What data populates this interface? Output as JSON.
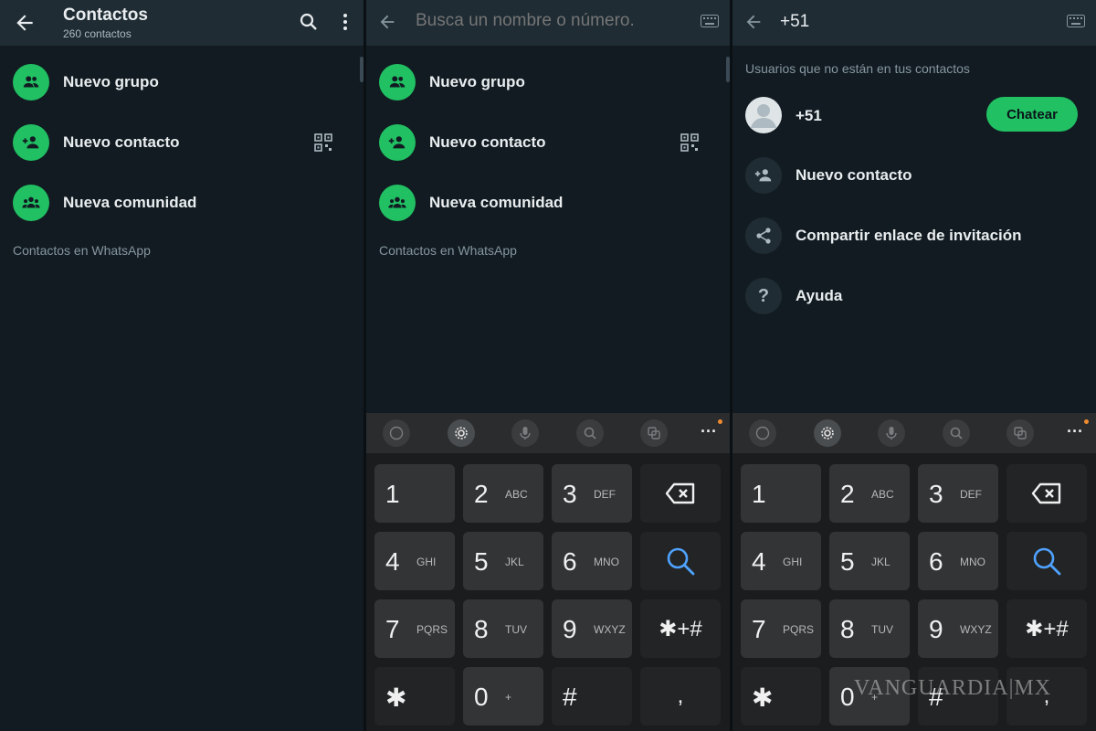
{
  "panel1": {
    "title": "Contactos",
    "subtitle": "260 contactos",
    "items": [
      {
        "label": "Nuevo grupo",
        "icon": "group-icon"
      },
      {
        "label": "Nuevo contacto",
        "icon": "add-person-icon"
      },
      {
        "label": "Nueva comunidad",
        "icon": "community-icon"
      }
    ],
    "section": "Contactos en WhatsApp"
  },
  "panel2": {
    "search_placeholder": "Busca un nombre o número.",
    "items": [
      {
        "label": "Nuevo grupo",
        "icon": "group-icon"
      },
      {
        "label": "Nuevo contacto",
        "icon": "add-person-icon"
      },
      {
        "label": "Nueva comunidad",
        "icon": "community-icon"
      }
    ],
    "section": "Contactos en WhatsApp"
  },
  "panel3": {
    "search_value": "+51",
    "section": "Usuarios que no están en tus contactos",
    "number": "+51",
    "chat_button": "Chatear",
    "items": [
      {
        "label": "Nuevo contacto",
        "icon": "add-person-icon"
      },
      {
        "label": "Compartir enlace de invitación",
        "icon": "share-icon"
      },
      {
        "label": "Ayuda",
        "icon": "help-icon"
      }
    ]
  },
  "keyboard": {
    "keys": [
      {
        "num": "1",
        "sub": ""
      },
      {
        "num": "2",
        "sub": "ABC"
      },
      {
        "num": "3",
        "sub": "DEF"
      },
      {
        "num": "4",
        "sub": "GHI"
      },
      {
        "num": "5",
        "sub": "JKL"
      },
      {
        "num": "6",
        "sub": "MNO"
      },
      {
        "num": "7",
        "sub": "PQRS"
      },
      {
        "num": "8",
        "sub": "TUV"
      },
      {
        "num": "9",
        "sub": "WXYZ"
      },
      {
        "num": "✱",
        "sub": ""
      },
      {
        "num": "0",
        "sub": "+"
      },
      {
        "num": "#",
        "sub": ""
      }
    ],
    "symbol_key": "✱+#",
    "comma_key": ","
  },
  "watermark": "VANGUARDIA|MX",
  "colors": {
    "accent": "#21c063",
    "background": "#111b21",
    "header": "#1f2c34"
  }
}
